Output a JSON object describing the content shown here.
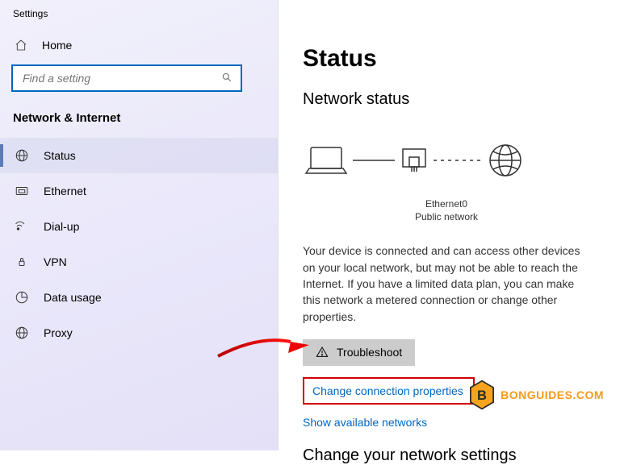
{
  "window": {
    "title": "Settings"
  },
  "sidebar": {
    "home_label": "Home",
    "search_placeholder": "Find a setting",
    "category_title": "Network & Internet",
    "items": [
      {
        "label": "Status"
      },
      {
        "label": "Ethernet"
      },
      {
        "label": "Dial-up"
      },
      {
        "label": "VPN"
      },
      {
        "label": "Data usage"
      },
      {
        "label": "Proxy"
      }
    ]
  },
  "main": {
    "page_title": "Status",
    "section_title": "Network status",
    "adapter_name": "Ethernet0",
    "adapter_profile": "Public network",
    "status_text": "Your device is connected and can access other devices on your local network, but may not be able to reach the Internet. If you have a limited data plan, you can make this network a metered connection or change other properties.",
    "troubleshoot_label": "Troubleshoot",
    "link_change_props": "Change connection properties",
    "link_show_networks": "Show available networks",
    "settings_heading": "Change your network settings"
  },
  "watermark": {
    "text": "BONGUIDES.COM",
    "initial": "B"
  }
}
